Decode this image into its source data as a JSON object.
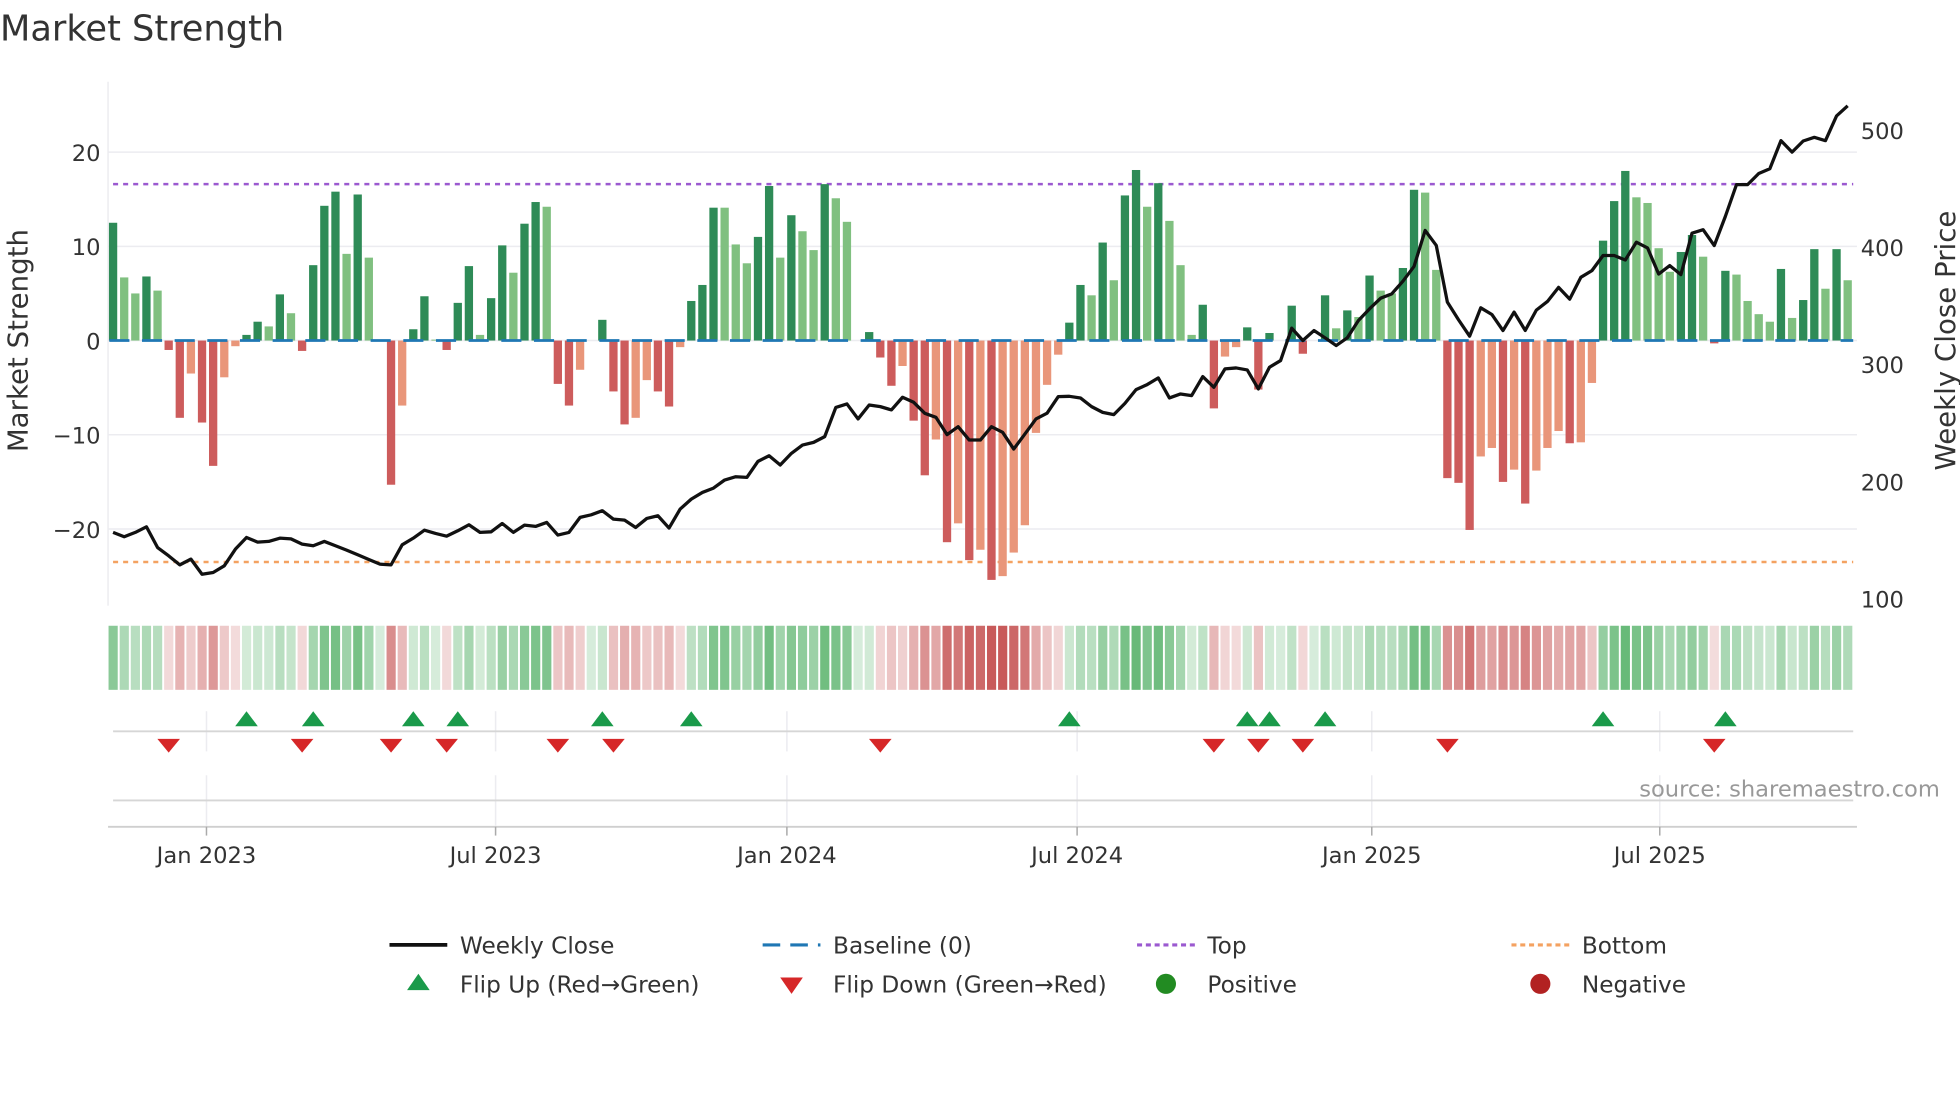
{
  "chart_data": {
    "type": "bar",
    "title": "Market Strength",
    "ylabel_left": "Market Strength",
    "ylabel_right": "Weekly Close Price",
    "ylim_left": [
      -27,
      26
    ],
    "ylim_right": [
      80,
      530
    ],
    "left_ticks": [
      {
        "value": 20,
        "label": "20"
      },
      {
        "value": 10,
        "label": "10"
      },
      {
        "value": 0,
        "label": "0"
      },
      {
        "value": -10,
        "label": "−10"
      },
      {
        "value": -20,
        "label": "−20"
      }
    ],
    "right_ticks": [
      {
        "value": 500,
        "label": "500"
      },
      {
        "value": 400,
        "label": "400"
      },
      {
        "value": 300,
        "label": "300"
      },
      {
        "value": 200,
        "label": "200"
      },
      {
        "value": 100,
        "label": "100"
      }
    ],
    "x_ticks": [
      {
        "label": "Jan 2023",
        "week_index": 8.4
      },
      {
        "label": "Jul 2023",
        "week_index": 34.4
      },
      {
        "label": "Jan 2024",
        "week_index": 60.6
      },
      {
        "label": "Jul 2024",
        "week_index": 86.7
      },
      {
        "label": "Jan 2025",
        "week_index": 113.2
      },
      {
        "label": "Jul 2025",
        "week_index": 139.1
      }
    ],
    "top_level": 16.6,
    "bottom_level": -23.5,
    "baseline": 0,
    "grid": true,
    "legend_position": "bottom",
    "series": [
      {
        "name": "Market Strength",
        "type": "bar",
        "values": [
          12.5,
          6.7,
          5.0,
          6.8,
          5.3,
          -1.0,
          -8.2,
          -3.5,
          -8.7,
          -13.3,
          -3.9,
          -0.6,
          0.6,
          2.0,
          1.5,
          4.9,
          2.9,
          -1.1,
          8.0,
          14.3,
          15.8,
          9.2,
          15.5,
          8.8,
          0,
          -15.3,
          -6.9,
          1.2,
          4.7,
          0.1,
          -1.0,
          4.0,
          7.9,
          0.6,
          4.5,
          10.1,
          7.2,
          12.4,
          14.7,
          14.2,
          -4.6,
          -6.9,
          -3.1,
          0,
          2.2,
          -5.4,
          -8.9,
          -8.2,
          -4.2,
          -5.4,
          -7.0,
          -0.7,
          4.2,
          5.9,
          14.1,
          14.1,
          10.2,
          8.2,
          11.0,
          16.4,
          8.8,
          13.3,
          11.6,
          9.6,
          16.6,
          15.1,
          12.6,
          0,
          0.9,
          -1.8,
          -4.8,
          -2.7,
          -8.5,
          -14.3,
          -10.5,
          -21.4,
          -19.4,
          -23.3,
          -22.2,
          -25.4,
          -25.0,
          -22.5,
          -19.6,
          -9.8,
          -4.7,
          -1.5,
          1.9,
          5.9,
          4.8,
          10.4,
          6.4,
          15.4,
          18.1,
          14.2,
          16.7,
          12.7,
          8.0,
          0.6,
          3.8,
          -7.2,
          -1.7,
          -0.7,
          1.4,
          -5.2,
          0.8,
          0,
          3.7,
          -1.4,
          0,
          4.8,
          1.3,
          3.2,
          2.5,
          6.9,
          5.3,
          5.0,
          7.7,
          16.0,
          15.7,
          7.5,
          -14.6,
          -15.1,
          -20.1,
          -12.3,
          -11.4,
          -15.0,
          -13.7,
          -17.3,
          -13.8,
          -11.4,
          -9.6,
          -10.9,
          -10.8,
          -4.5,
          10.6,
          14.8,
          18.0,
          15.2,
          14.6,
          9.8,
          7.3,
          9.4,
          11.2,
          8.9,
          -0.3,
          7.4,
          7.0,
          4.2,
          2.8,
          2.0,
          7.6,
          2.4,
          4.3,
          9.7,
          5.5,
          9.7,
          6.4
        ]
      },
      {
        "name": "Weekly Close",
        "type": "line",
        "axis": "right",
        "values": [
          156.7,
          153,
          156.7,
          161.5,
          143.8,
          136.7,
          129,
          133.9,
          121,
          122.5,
          128.2,
          142.4,
          152.4,
          148.4,
          149,
          151.8,
          151.2,
          146.7,
          145.3,
          149,
          145.3,
          141.6,
          137.6,
          133.6,
          129.6,
          129,
          146.1,
          151.8,
          158.6,
          155.8,
          153.5,
          158.1,
          163.2,
          156.7,
          157.2,
          164.3,
          156.7,
          162.9,
          161.8,
          165.2,
          154.4,
          156.7,
          169.5,
          171.7,
          175.2,
          168,
          167.2,
          160.9,
          168.6,
          170.9,
          160.4,
          176.6,
          185.1,
          190.8,
          194.5,
          201.4,
          204.2,
          203.6,
          217.3,
          222.1,
          214.2,
          224.1,
          231.2,
          233.5,
          238.4,
          263.3,
          266.3,
          253.5,
          265.4,
          264,
          261.2,
          272,
          267.7,
          258.3,
          254.9,
          240.1,
          246.9,
          235.5,
          235.5,
          246.9,
          242.1,
          227.8,
          240.6,
          253.5,
          258.4,
          272.5,
          272.8,
          271.4,
          264,
          259.1,
          257.2,
          266.8,
          278.5,
          282.8,
          288.5,
          271.4,
          274.8,
          273.4,
          289.6,
          280.5,
          296.2,
          297,
          295.3,
          279.1,
          297.6,
          303.3,
          330.9,
          320.4,
          328.9,
          322.7,
          316.1,
          322.7,
          337.5,
          347.4,
          356.5,
          360.2,
          371,
          383.6,
          414.3,
          401.5,
          353.1,
          338.1,
          324.1,
          348.3,
          342.6,
          328.9,
          344.6,
          329,
          346.3,
          353.7,
          365.7,
          355.7,
          374.3,
          380,
          392.9,
          392.9,
          389.1,
          404.3,
          399.4,
          377.1,
          384.3,
          376.6,
          412,
          414.9,
          401.4,
          426.3,
          453.4,
          453.4,
          462.9,
          466.9,
          490.9,
          481.1,
          490.6,
          493.7,
          490.9,
          512,
          520.6
        ]
      }
    ],
    "legend": [
      {
        "label": "Weekly Close",
        "symbol": "line-solid",
        "color": "#111111"
      },
      {
        "label": "Baseline (0)",
        "symbol": "line-dashed",
        "color": "#1f77b4"
      },
      {
        "label": "Top",
        "symbol": "line-dotted",
        "color": "#9b59d0"
      },
      {
        "label": "Bottom",
        "symbol": "line-dotted",
        "color": "#f4a261"
      },
      {
        "label": "Flip Up (Red→Green)",
        "symbol": "triangle-up",
        "color": "#1a9a4a"
      },
      {
        "label": "Flip Down (Green→Red)",
        "symbol": "triangle-down",
        "color": "#d62728"
      },
      {
        "label": "Positive",
        "symbol": "circle",
        "color": "#228b22"
      },
      {
        "label": "Negative",
        "symbol": "circle",
        "color": "#b22222"
      }
    ],
    "colors": {
      "pos_strong": "#2e8b57",
      "pos_weak": "#80c080",
      "neg_strong": "#cd5c5c",
      "neg_weak": "#e9967a",
      "baseline": "#1f77b4",
      "top": "#9b59d0",
      "bottom": "#f4a261",
      "flip_up": "#1a9a4a",
      "flip_down": "#d62728",
      "price": "#111111"
    },
    "source": "source: sharemaestro.com"
  }
}
